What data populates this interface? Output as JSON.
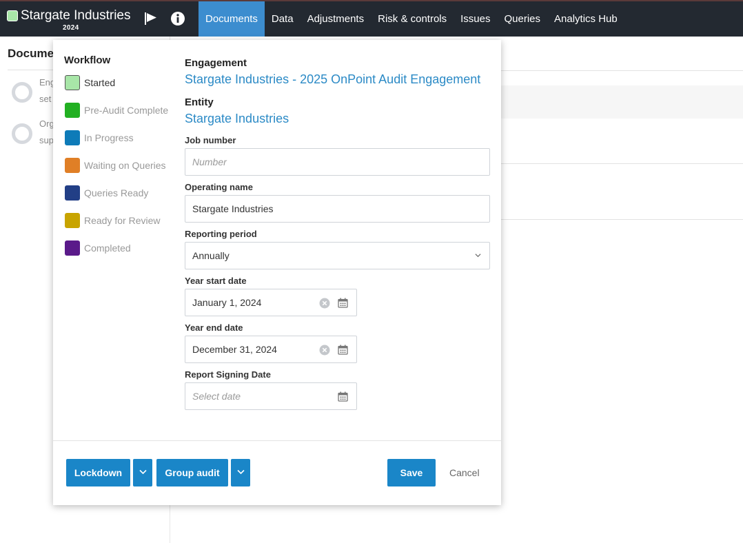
{
  "header": {
    "brand_name": "Stargate Industries",
    "brand_year": "2024",
    "brand_color": "#a8e6a8",
    "icons": [
      "flag-icon",
      "info-icon"
    ],
    "tabs": [
      {
        "label": "Documents",
        "active": true
      },
      {
        "label": "Data",
        "active": false
      },
      {
        "label": "Adjustments",
        "active": false
      },
      {
        "label": "Risk & controls",
        "active": false
      },
      {
        "label": "Issues",
        "active": false
      },
      {
        "label": "Queries",
        "active": false
      },
      {
        "label": "Analytics Hub",
        "active": false
      }
    ]
  },
  "background": {
    "title": "Docume",
    "items": [
      {
        "line1": "Eng",
        "line2": "set"
      },
      {
        "line1": "Org",
        "line2": "sup"
      }
    ]
  },
  "workflow": {
    "title": "Workflow",
    "items": [
      {
        "label": "Started",
        "color": "#a8e6a8",
        "selected": true
      },
      {
        "label": "Pre-Audit Complete",
        "color": "#22b022",
        "selected": false
      },
      {
        "label": "In Progress",
        "color": "#0e7bb8",
        "selected": false
      },
      {
        "label": "Waiting on Queries",
        "color": "#e07f26",
        "selected": false
      },
      {
        "label": "Queries Ready",
        "color": "#223f86",
        "selected": false
      },
      {
        "label": "Ready for Review",
        "color": "#c8a400",
        "selected": false
      },
      {
        "label": "Completed",
        "color": "#5a1a8a",
        "selected": false
      }
    ]
  },
  "form": {
    "engagement_label": "Engagement",
    "engagement_value": "Stargate Industries - 2025 OnPoint Audit Engagement",
    "entity_label": "Entity",
    "entity_value": "Stargate Industries",
    "job_number_label": "Job number",
    "job_number_placeholder": "Number",
    "job_number_value": "",
    "operating_name_label": "Operating name",
    "operating_name_value": "Stargate Industries",
    "reporting_period_label": "Reporting period",
    "reporting_period_value": "Annually",
    "year_start_label": "Year start date",
    "year_start_value": "January 1, 2024",
    "year_end_label": "Year end date",
    "year_end_value": "December 31, 2024",
    "signing_label": "Report Signing Date",
    "signing_placeholder": "Select date"
  },
  "footer": {
    "lockdown_label": "Lockdown",
    "group_audit_label": "Group audit",
    "save_label": "Save",
    "cancel_label": "Cancel",
    "accent_color": "#1a86c8"
  }
}
